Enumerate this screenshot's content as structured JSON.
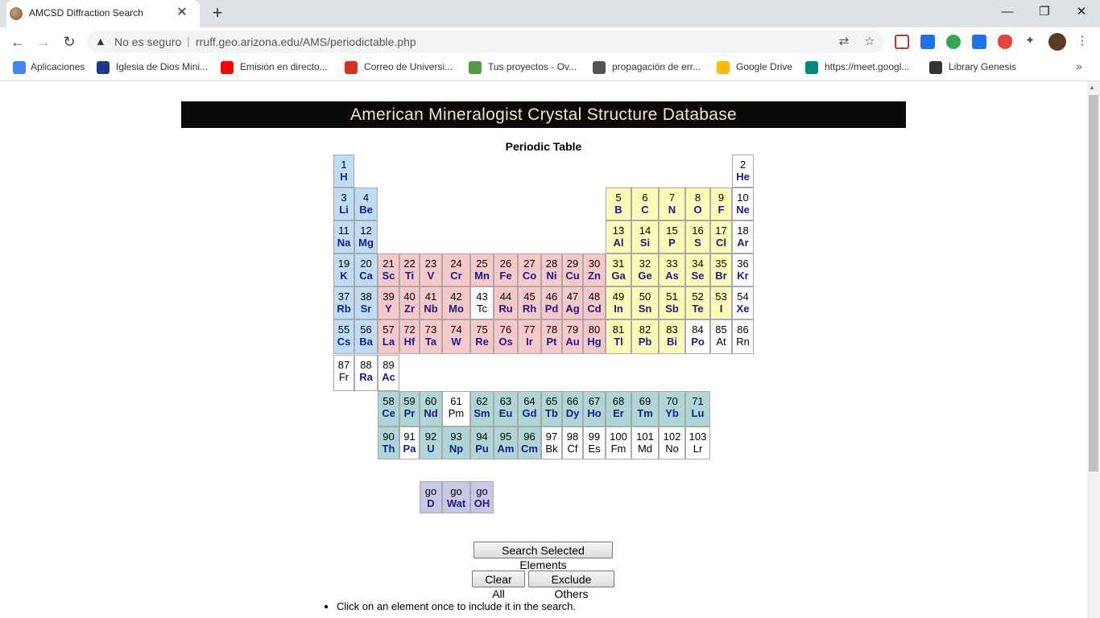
{
  "browser": {
    "tab_title": "AMCSD Diffraction Search",
    "tab_close": "✕",
    "new_tab": "+",
    "window": {
      "minimize": "—",
      "restore": "❐",
      "close": "✕"
    },
    "nav": {
      "back": "←",
      "forward": "→",
      "reload": "↻"
    },
    "security_label": "No es seguro",
    "url_separator": "|",
    "url": "rruff.geo.arizona.edu/AMS/periodictable.php",
    "bookmarks": [
      {
        "label": "Aplicaciones",
        "icon": "apps-grid-icon",
        "color": "#4285f4"
      },
      {
        "label": "Iglesia de Dios Mini...",
        "icon": "church-icon",
        "color": "#1b3a8c"
      },
      {
        "label": "Emisión en directo...",
        "icon": "youtube-icon",
        "color": "#ff0000"
      },
      {
        "label": "Correo de Universi...",
        "icon": "gmail-icon",
        "color": "#d93025"
      },
      {
        "label": "Tus proyectos - Ov...",
        "icon": "overleaf-icon",
        "color": "#4f9c45"
      },
      {
        "label": "propagación de err...",
        "icon": "globe-icon",
        "color": "#555555"
      },
      {
        "label": "Google Drive",
        "icon": "drive-icon",
        "color": "#fbbc04"
      },
      {
        "label": "https://meet.googl...",
        "icon": "meet-icon",
        "color": "#00897b"
      },
      {
        "label": "Library Genesis",
        "icon": "library-icon",
        "color": "#333333"
      }
    ],
    "more_bookmarks": "»"
  },
  "page": {
    "banner_title": "American Mineralogist Crystal Structure Database",
    "table_title": "Periodic Table",
    "colors": {
      "blue": "#bfdcf5",
      "pink": "#f7c8c8",
      "yellow": "#fbfbb6",
      "teal": "#aed6d6",
      "lavender": "#c7c7e6",
      "white": "#ffffff"
    },
    "elements": [
      {
        "n": "1",
        "s": "H",
        "c": "blue"
      },
      {
        "n": "2",
        "s": "He",
        "c": "white"
      },
      {
        "n": "3",
        "s": "Li",
        "c": "blue"
      },
      {
        "n": "4",
        "s": "Be",
        "c": "blue"
      },
      {
        "n": "5",
        "s": "B",
        "c": "yellow"
      },
      {
        "n": "6",
        "s": "C",
        "c": "yellow"
      },
      {
        "n": "7",
        "s": "N",
        "c": "yellow"
      },
      {
        "n": "8",
        "s": "O",
        "c": "yellow"
      },
      {
        "n": "9",
        "s": "F",
        "c": "yellow"
      },
      {
        "n": "10",
        "s": "Ne",
        "c": "white"
      },
      {
        "n": "11",
        "s": "Na",
        "c": "blue"
      },
      {
        "n": "12",
        "s": "Mg",
        "c": "blue"
      },
      {
        "n": "13",
        "s": "Al",
        "c": "yellow"
      },
      {
        "n": "14",
        "s": "Si",
        "c": "yellow"
      },
      {
        "n": "15",
        "s": "P",
        "c": "yellow"
      },
      {
        "n": "16",
        "s": "S",
        "c": "yellow"
      },
      {
        "n": "17",
        "s": "Cl",
        "c": "yellow"
      },
      {
        "n": "18",
        "s": "Ar",
        "c": "white"
      },
      {
        "n": "19",
        "s": "K",
        "c": "blue"
      },
      {
        "n": "20",
        "s": "Ca",
        "c": "blue"
      },
      {
        "n": "21",
        "s": "Sc",
        "c": "pink"
      },
      {
        "n": "22",
        "s": "Ti",
        "c": "pink"
      },
      {
        "n": "23",
        "s": "V",
        "c": "pink"
      },
      {
        "n": "24",
        "s": "Cr",
        "c": "pink"
      },
      {
        "n": "25",
        "s": "Mn",
        "c": "pink"
      },
      {
        "n": "26",
        "s": "Fe",
        "c": "pink"
      },
      {
        "n": "27",
        "s": "Co",
        "c": "pink"
      },
      {
        "n": "28",
        "s": "Ni",
        "c": "pink"
      },
      {
        "n": "29",
        "s": "Cu",
        "c": "pink"
      },
      {
        "n": "30",
        "s": "Zn",
        "c": "pink"
      },
      {
        "n": "31",
        "s": "Ga",
        "c": "yellow"
      },
      {
        "n": "32",
        "s": "Ge",
        "c": "yellow"
      },
      {
        "n": "33",
        "s": "As",
        "c": "yellow"
      },
      {
        "n": "34",
        "s": "Se",
        "c": "yellow"
      },
      {
        "n": "35",
        "s": "Br",
        "c": "yellow"
      },
      {
        "n": "36",
        "s": "Kr",
        "c": "white"
      },
      {
        "n": "37",
        "s": "Rb",
        "c": "blue"
      },
      {
        "n": "38",
        "s": "Sr",
        "c": "blue"
      },
      {
        "n": "39",
        "s": "Y",
        "c": "pink"
      },
      {
        "n": "40",
        "s": "Zr",
        "c": "pink"
      },
      {
        "n": "41",
        "s": "Nb",
        "c": "pink"
      },
      {
        "n": "42",
        "s": "Mo",
        "c": "pink"
      },
      {
        "n": "43",
        "s": "Tc",
        "c": "white",
        "e": true
      },
      {
        "n": "44",
        "s": "Ru",
        "c": "pink"
      },
      {
        "n": "45",
        "s": "Rh",
        "c": "pink"
      },
      {
        "n": "46",
        "s": "Pd",
        "c": "pink"
      },
      {
        "n": "47",
        "s": "Ag",
        "c": "pink"
      },
      {
        "n": "48",
        "s": "Cd",
        "c": "pink"
      },
      {
        "n": "49",
        "s": "In",
        "c": "yellow"
      },
      {
        "n": "50",
        "s": "Sn",
        "c": "yellow"
      },
      {
        "n": "51",
        "s": "Sb",
        "c": "yellow"
      },
      {
        "n": "52",
        "s": "Te",
        "c": "yellow"
      },
      {
        "n": "53",
        "s": "I",
        "c": "yellow"
      },
      {
        "n": "54",
        "s": "Xe",
        "c": "white"
      },
      {
        "n": "55",
        "s": "Cs",
        "c": "blue"
      },
      {
        "n": "56",
        "s": "Ba",
        "c": "blue"
      },
      {
        "n": "57",
        "s": "La",
        "c": "pink"
      },
      {
        "n": "72",
        "s": "Hf",
        "c": "pink"
      },
      {
        "n": "73",
        "s": "Ta",
        "c": "pink"
      },
      {
        "n": "74",
        "s": "W",
        "c": "pink"
      },
      {
        "n": "75",
        "s": "Re",
        "c": "pink"
      },
      {
        "n": "76",
        "s": "Os",
        "c": "pink"
      },
      {
        "n": "77",
        "s": "Ir",
        "c": "pink"
      },
      {
        "n": "78",
        "s": "Pt",
        "c": "pink"
      },
      {
        "n": "79",
        "s": "Au",
        "c": "pink"
      },
      {
        "n": "80",
        "s": "Hg",
        "c": "pink"
      },
      {
        "n": "81",
        "s": "Tl",
        "c": "yellow"
      },
      {
        "n": "82",
        "s": "Pb",
        "c": "yellow"
      },
      {
        "n": "83",
        "s": "Bi",
        "c": "yellow"
      },
      {
        "n": "84",
        "s": "Po",
        "c": "white"
      },
      {
        "n": "85",
        "s": "At",
        "c": "white",
        "e": true
      },
      {
        "n": "86",
        "s": "Rn",
        "c": "white",
        "e": true
      },
      {
        "n": "87",
        "s": "Fr",
        "c": "white",
        "e": true
      },
      {
        "n": "88",
        "s": "Ra",
        "c": "white"
      },
      {
        "n": "89",
        "s": "Ac",
        "c": "white"
      },
      {
        "n": "58",
        "s": "Ce",
        "c": "teal"
      },
      {
        "n": "59",
        "s": "Pr",
        "c": "teal"
      },
      {
        "n": "60",
        "s": "Nd",
        "c": "teal"
      },
      {
        "n": "61",
        "s": "Pm",
        "c": "white",
        "e": true
      },
      {
        "n": "62",
        "s": "Sm",
        "c": "teal"
      },
      {
        "n": "63",
        "s": "Eu",
        "c": "teal"
      },
      {
        "n": "64",
        "s": "Gd",
        "c": "teal"
      },
      {
        "n": "65",
        "s": "Tb",
        "c": "teal"
      },
      {
        "n": "66",
        "s": "Dy",
        "c": "teal"
      },
      {
        "n": "67",
        "s": "Ho",
        "c": "teal"
      },
      {
        "n": "68",
        "s": "Er",
        "c": "teal"
      },
      {
        "n": "69",
        "s": "Tm",
        "c": "teal"
      },
      {
        "n": "70",
        "s": "Yb",
        "c": "teal"
      },
      {
        "n": "71",
        "s": "Lu",
        "c": "teal"
      },
      {
        "n": "90",
        "s": "Th",
        "c": "teal"
      },
      {
        "n": "91",
        "s": "Pa",
        "c": "white"
      },
      {
        "n": "92",
        "s": "U",
        "c": "teal"
      },
      {
        "n": "93",
        "s": "Np",
        "c": "teal"
      },
      {
        "n": "94",
        "s": "Pu",
        "c": "teal"
      },
      {
        "n": "95",
        "s": "Am",
        "c": "teal"
      },
      {
        "n": "96",
        "s": "Cm",
        "c": "teal"
      },
      {
        "n": "97",
        "s": "Bk",
        "c": "white",
        "e": true
      },
      {
        "n": "98",
        "s": "Cf",
        "c": "white",
        "e": true
      },
      {
        "n": "99",
        "s": "Es",
        "c": "white",
        "e": true
      },
      {
        "n": "100",
        "s": "Fm",
        "c": "white",
        "e": true
      },
      {
        "n": "101",
        "s": "Md",
        "c": "white",
        "e": true
      },
      {
        "n": "102",
        "s": "No",
        "c": "white",
        "e": true
      },
      {
        "n": "103",
        "s": "Lr",
        "c": "white",
        "e": true
      },
      {
        "n": "go",
        "s": "D",
        "c": "lavender"
      },
      {
        "n": "go",
        "s": "Wat",
        "c": "lavender"
      },
      {
        "n": "go",
        "s": "OH",
        "c": "lavender"
      }
    ],
    "buttons": {
      "search": "Search Selected Elements",
      "clear": "Clear All",
      "exclude": "Exclude Others"
    },
    "instructions": [
      "Click on an element once to include it in the search."
    ]
  }
}
